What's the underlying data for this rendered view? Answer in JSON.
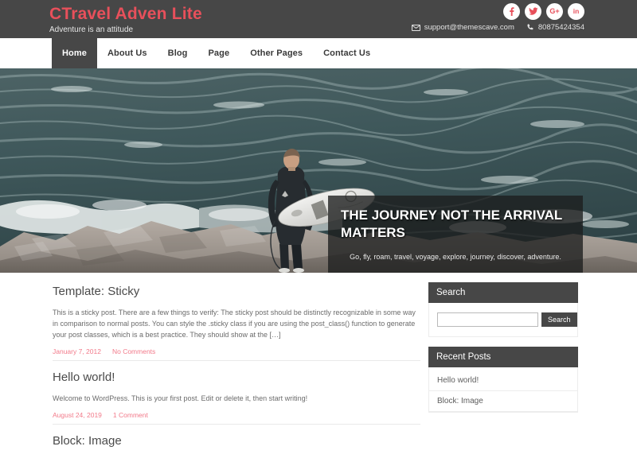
{
  "header": {
    "site_title": "CTravel Adven Lite",
    "tagline": "Adventure is an attitude",
    "social": [
      {
        "name": "facebook-icon",
        "glyph": "f"
      },
      {
        "name": "twitter-icon",
        "glyph": "t"
      },
      {
        "name": "google-plus-icon",
        "glyph": "G+"
      },
      {
        "name": "linkedin-icon",
        "glyph": "in"
      }
    ],
    "email": "support@themescave.com",
    "phone": "80875424354",
    "bg_color": "#474747",
    "title_color": "#e8505b"
  },
  "nav": {
    "items": [
      {
        "label": "Home",
        "active": true
      },
      {
        "label": "About Us",
        "active": false
      },
      {
        "label": "Blog",
        "active": false
      },
      {
        "label": "Page",
        "active": false
      },
      {
        "label": "Other Pages",
        "active": false
      },
      {
        "label": "Contact Us",
        "active": false
      }
    ]
  },
  "hero": {
    "heading": "THE JOURNEY NOT THE ARRIVAL MATTERS",
    "subtitle": "Go, fly, roam, travel, voyage, explore, journey, discover, adventure.",
    "image_alt": "surfer-standing-on-rocks-holding-white-surfboard-facing-ocean"
  },
  "posts": [
    {
      "title": "Template: Sticky",
      "excerpt": "This is a sticky post. There are a few things to verify: The sticky post should be distinctly recognizable in some way in comparison to normal posts. You can style the .sticky class if you are using the post_class() function to generate your post classes, which is a best practice. They should show at the […]",
      "date": "January 7, 2012",
      "comments": "No Comments"
    },
    {
      "title": "Hello world!",
      "excerpt": "Welcome to WordPress. This is your first post. Edit or delete it, then start writing!",
      "date": "August 24, 2019",
      "comments": "1 Comment"
    },
    {
      "title": "Block: Image",
      "excerpt": "",
      "date": "",
      "comments": ""
    }
  ],
  "sidebar": {
    "search": {
      "heading": "Search",
      "value": "",
      "placeholder": "",
      "button_label": "Search"
    },
    "recent_posts": {
      "heading": "Recent Posts",
      "items": [
        {
          "label": "Hello world!"
        },
        {
          "label": "Block: Image"
        }
      ]
    }
  }
}
